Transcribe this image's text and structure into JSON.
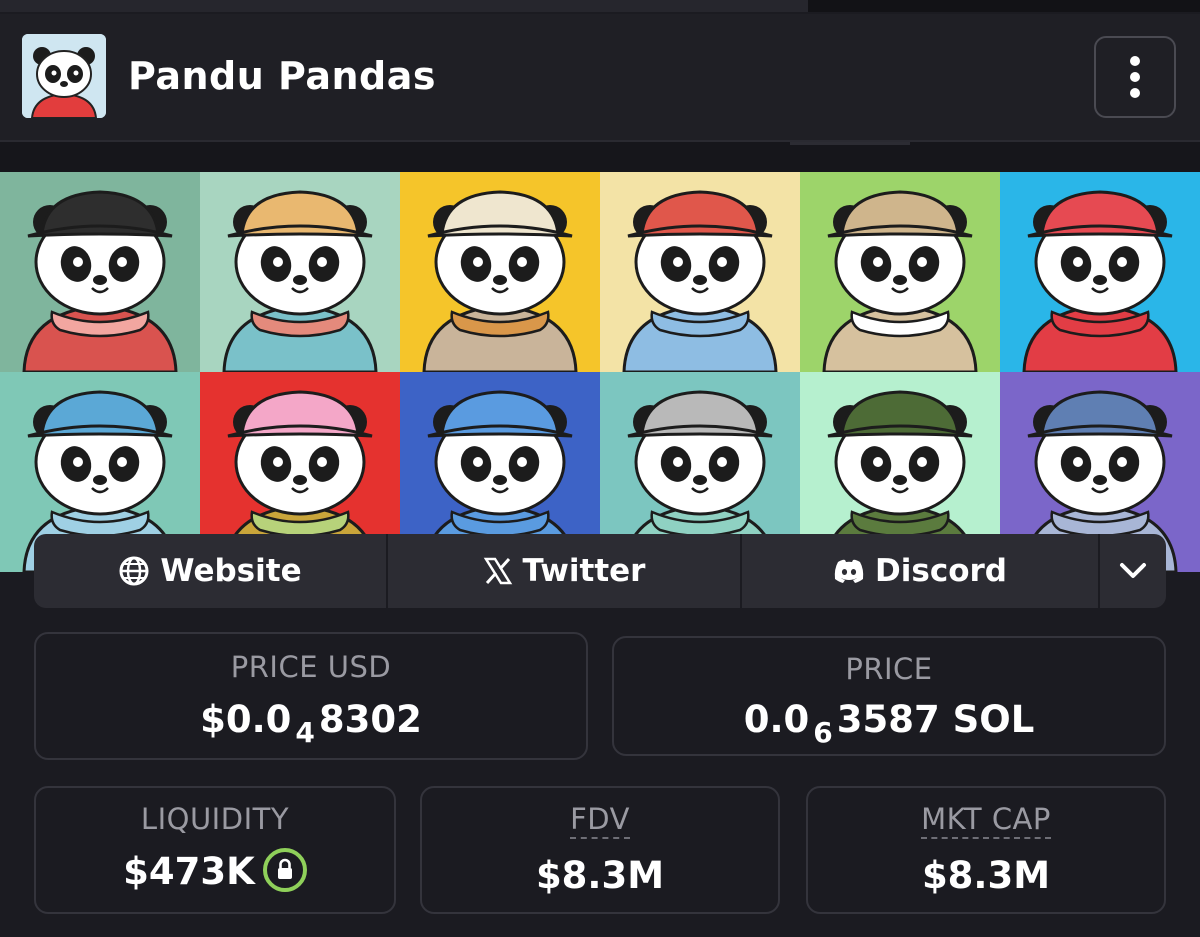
{
  "header": {
    "title": "Pandu Pandas"
  },
  "links": {
    "website": "Website",
    "twitter": "Twitter",
    "discord": "Discord"
  },
  "stats": {
    "price_usd": {
      "label": "PRICE USD",
      "prefix": "$0.0",
      "sub": "4",
      "suffix": "8302"
    },
    "price": {
      "label": "PRICE",
      "prefix": "0.0",
      "sub": "6",
      "suffix": "3587 SOL"
    },
    "liquidity": {
      "label": "LIQUIDITY",
      "value": "$473K"
    },
    "fdv": {
      "label": "FDV",
      "value": "$8.3M"
    },
    "mkt_cap": {
      "label": "MKT CAP",
      "value": "$8.3M"
    }
  },
  "banner": {
    "tiles": [
      {
        "bg": "#7fb59d",
        "hat": "#2e2e2e",
        "shirt": "#d9534f",
        "scarf": "#f2a6a0"
      },
      {
        "bg": "#a8d5c0",
        "hat": "#e9b870",
        "shirt": "#7ac1c9",
        "scarf": "#e48a7c"
      },
      {
        "bg": "#f5c52a",
        "hat": "#efe6cf",
        "shirt": "#c9b49a",
        "scarf": "#d9974a"
      },
      {
        "bg": "#f3e3a6",
        "hat": "#e0574b",
        "shirt": "#8ebde3",
        "scarf": "#8ebde3"
      },
      {
        "bg": "#9dd46a",
        "hat": "#cfb58c",
        "shirt": "#d6c19e",
        "scarf": "#ffffff"
      },
      {
        "bg": "#2ab6e8",
        "hat": "#e64a52",
        "shirt": "#e23d45",
        "scarf": "#e23d45"
      },
      {
        "bg": "#7fc8b6",
        "hat": "#5ba8d6",
        "shirt": "#9fd0e4",
        "scarf": "#9fd0e4"
      },
      {
        "bg": "#e5322f",
        "hat": "#f4a7c8",
        "shirt": "#c9a53a",
        "scarf": "#b7d27a"
      },
      {
        "bg": "#3d63c6",
        "hat": "#5a9be0",
        "shirt": "#5a9be0",
        "scarf": "#5a9be0"
      },
      {
        "bg": "#7cc6c0",
        "hat": "#b9b9b9",
        "shirt": "#8fd1c2",
        "scarf": "#8fd1c2"
      },
      {
        "bg": "#b6f0cf",
        "hat": "#4d6b36",
        "shirt": "#5b7b3e",
        "scarf": "#5b7b3e"
      },
      {
        "bg": "#7b66c9",
        "hat": "#5f7fb3",
        "shirt": "#a8b6d6",
        "scarf": "#a8b6d6"
      }
    ]
  },
  "colors": {
    "accent_lock": "#8fd05a",
    "background": "#1b1b21"
  }
}
